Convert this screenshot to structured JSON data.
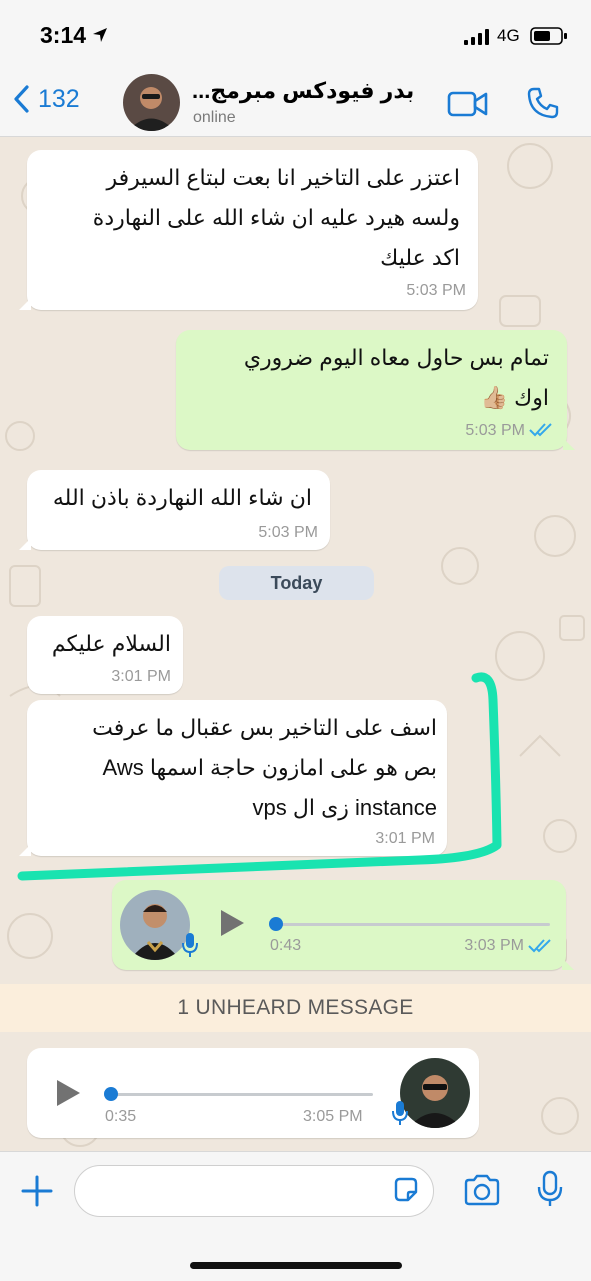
{
  "status_bar": {
    "time": "3:14",
    "network": "4G"
  },
  "header": {
    "back_count": "132",
    "contact_name": "بدر فيودكس مبرمج...",
    "contact_status": "online"
  },
  "messages": [
    {
      "id": "m1",
      "direction": "in",
      "lines": [
        "اعتزر على التاخير  انا بعت لبتاع السيرفر",
        "ولسه هيرد عليه ان شاء الله على النهاردة",
        "اكد عليك"
      ],
      "time": "5:03 PM"
    },
    {
      "id": "m2",
      "direction": "out",
      "lines": [
        "تمام بس حاول معاه اليوم ضروري",
        "اوك 👍🏼"
      ],
      "time": "5:03 PM",
      "read": true
    },
    {
      "id": "m3",
      "direction": "in",
      "lines": [
        "ان شاء الله النهاردة باذن الله"
      ],
      "time": "5:03 PM"
    },
    {
      "id": "m4",
      "direction": "in",
      "lines": [
        "السلام عليكم"
      ],
      "time": "3:01 PM"
    },
    {
      "id": "m5",
      "direction": "in",
      "lines": [
        "اسف على التاخير بس عقبال ما عرفت",
        "بص هو على امازون حاجة اسمها Aws",
        "instance زى ال vps"
      ],
      "time": "3:01 PM"
    }
  ],
  "date_separator": "Today",
  "voice_out": {
    "duration": "0:43",
    "time": "3:03 PM",
    "read": true
  },
  "unheard_banner": "1 UNHEARD MESSAGE",
  "voice_in": {
    "duration": "0:35",
    "time": "3:05 PM"
  },
  "composer": {
    "placeholder": ""
  },
  "colors": {
    "accent": "#1a7bd4",
    "outgoing_bubble": "#dcf8c6",
    "incoming_bubble": "#ffffff",
    "annotation": "#19e3b0",
    "unheard_banner": "#fbeedc"
  },
  "icons": [
    "location-arrow-icon",
    "signal-icon",
    "battery-icon",
    "back-chevron-icon",
    "video-call-icon",
    "phone-call-icon",
    "double-check-icon",
    "play-icon",
    "microphone-icon",
    "plus-icon",
    "sticker-icon",
    "camera-icon"
  ]
}
